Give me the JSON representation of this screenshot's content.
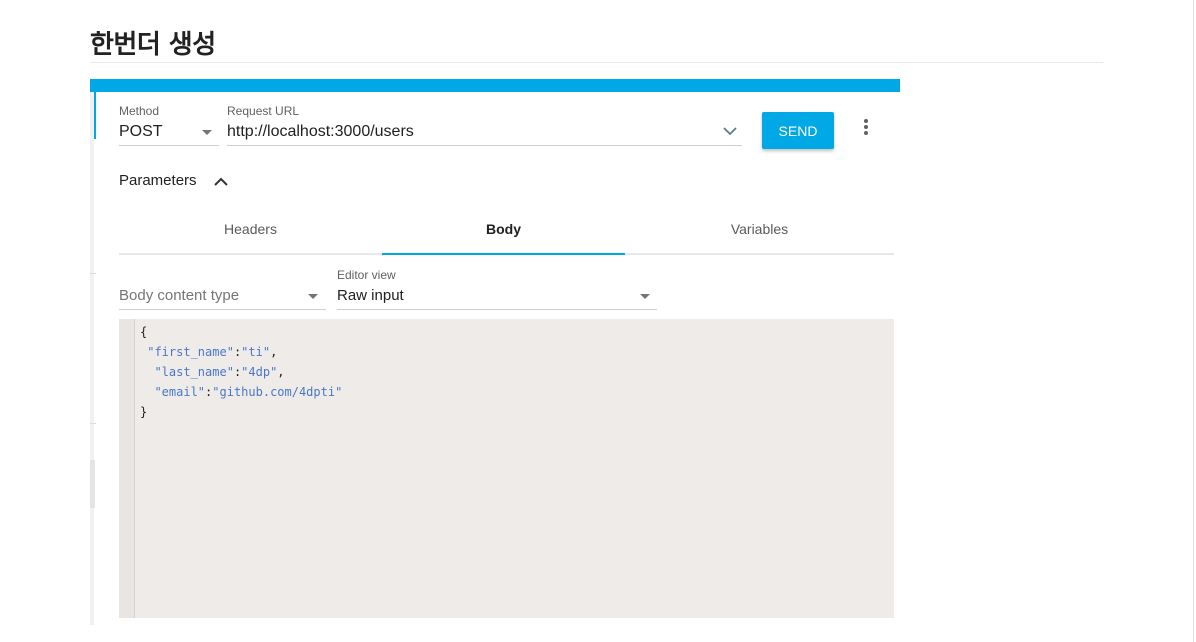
{
  "page": {
    "title": "한번더 생성"
  },
  "request": {
    "method_label": "Method",
    "method_value": "POST",
    "url_label": "Request URL",
    "url_value": "http://localhost:3000/users",
    "send_label": "SEND",
    "more_icon": "more-vert-icon"
  },
  "parameters": {
    "label": "Parameters",
    "toggle_icon": "chevron-up-icon"
  },
  "tabs": [
    {
      "label": "Headers",
      "active": false
    },
    {
      "label": "Body",
      "active": true
    },
    {
      "label": "Variables",
      "active": false
    }
  ],
  "body": {
    "content_type_placeholder": "Body content type",
    "editor_view_label": "Editor view",
    "editor_view_value": "Raw input",
    "code_lines": [
      {
        "indent": "",
        "key": "",
        "value": "",
        "text": "{"
      },
      {
        "indent": " ",
        "key": "\"first_name\"",
        "value": "\"ti\"",
        "text": ""
      },
      {
        "indent": "  ",
        "key": "\"last_name\"",
        "value": "\"4dp\"",
        "text": ""
      },
      {
        "indent": "  ",
        "key": "\"email\"",
        "value": "\"github.com/4dpti\"",
        "text": ""
      },
      {
        "indent": "",
        "key": "",
        "value": "",
        "text": "}"
      }
    ]
  },
  "colors": {
    "accent": "#00a8e6",
    "editor_bg": "#eeebe8",
    "json_string": "#4a78c8"
  }
}
